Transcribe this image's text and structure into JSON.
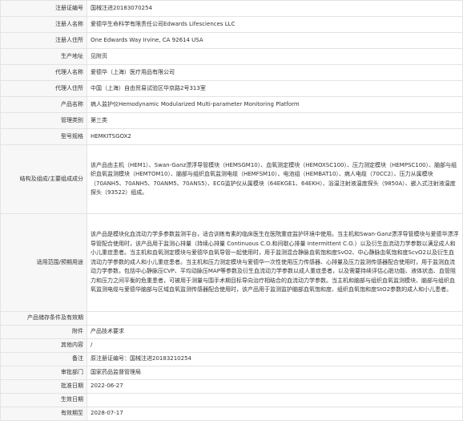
{
  "rows": [
    {
      "label": "注册证编号",
      "value": "国械注进20183070254"
    },
    {
      "label": "注册人名称",
      "value": "爱德华生命科学有限责任公司Edwards Lifesciences LLC"
    },
    {
      "label": "注册人住所",
      "value": "One Edwards Way Irvine, CA 92614 USA"
    },
    {
      "label": "生产地址",
      "value": "见附页"
    },
    {
      "label": "代理人名称",
      "value": "爱德华（上海）医疗用品有限公司"
    },
    {
      "label": "代理人住所",
      "value": "中国（上海）自由贸易试验区华京路2号313室"
    },
    {
      "label": "产品名称",
      "value": "病人监护仪Hemodynamic Modularized Multi-parameter Monitoring Platform"
    },
    {
      "label": "管理类别",
      "value": "第三类"
    },
    {
      "label": "型号规格",
      "value": "HEMKITSGOX2"
    },
    {
      "label": "结构及组成/主要组成成分",
      "value": "该产品由主机（HEM1）、Swan-Ganz漂浮导管模块（HEMSGM10）、血氧测定模块（HEMOXSC100）、压力测定模块（HEMPSC100）、脑部与组织血氧监测模块（HEMTOM10）、脑部与组织血氧监测电缆（HEMFSM10）、电池组（HEMBAT10）、病人电缆（70CC2）、压力从属模块（70ANH5、70ANH5、70ANM5、70ANS5）、ECG监护仪从属模块（64EKGE1、64EKH）、浴温注射液温度探头（9850A）、嵌入式注射液温度探头（93522）组成。"
    },
    {
      "label": "适用范围/预期用途",
      "value": "该产品是模块化血流动力学多参数监测平台，适合训练有素的临床医生在医院重症监护环境中使用。当主机和Swan-Ganz漂浮导管模块与爱德华漂浮导管配合使用时，该产品用于监测心排量（持续心排量 Continuous C.O.和间歇心排量 Intermittent C.O.）以及衍生血流动力学参数以满足成人和小儿重症患者。当主机和血氧测定模块与爱德华血氧导管一起使用时，用于监测混合静脉血氧饱和度SvO2、中心静脉血氧饱和度ScvO2以及衍生血流动力学参数的成人和小儿重症患者。当主机和压力测定模块与爱德华一次性使用压力传感器、心排量及压力监测传感器配合使用时，用于监测血流动力学参数，包括中心静脉压CVP、平均动脉压MAP等参数及衍生血流动力学参数以成人重症患者，以及需要持续评估心脏功能、液体状态、血管阻力和压力之间平衡的危重患者，可被用于测量与围手术期目标导向治疗相结合的血流动力学参数。当主机和脑部与组织血氧监测模块、脑部与组织血氧监测电缆与爱德华脑部与区域血氧监测传感器配合使用时，该产品用于监测监护脑部血氧饱和度、组织血氧饱和度StO2参数的成人和小儿患者。"
    },
    {
      "label": "产品储存条件及有效期",
      "value": ""
    },
    {
      "label": "附件",
      "value": "产品技术要求"
    },
    {
      "label": "其他内容",
      "value": "/"
    },
    {
      "label": "备注",
      "value": "原注册证编号：国械注进20183210254"
    },
    {
      "label": "审批部门",
      "value": "国家药品监督管理局"
    },
    {
      "label": "批准日期",
      "value": "2022-06-27"
    },
    {
      "label": "生效日期",
      "value": ""
    },
    {
      "label": "有效期至",
      "value": "2028-07-17"
    }
  ]
}
